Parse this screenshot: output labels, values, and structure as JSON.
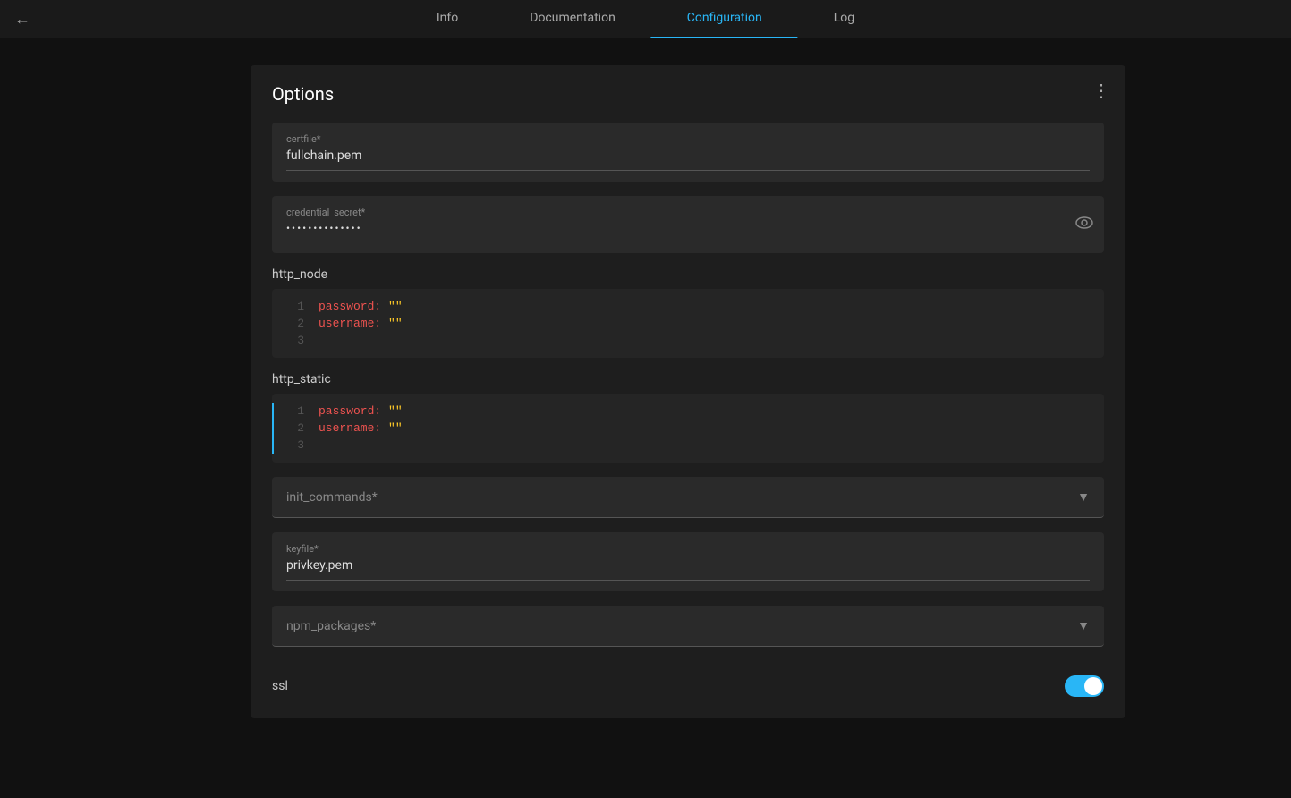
{
  "nav": {
    "back_label": "←",
    "tabs": [
      {
        "id": "info",
        "label": "Info",
        "active": false
      },
      {
        "id": "documentation",
        "label": "Documentation",
        "active": false
      },
      {
        "id": "configuration",
        "label": "Configuration",
        "active": true
      },
      {
        "id": "log",
        "label": "Log",
        "active": false
      }
    ]
  },
  "panel": {
    "title": "Options",
    "menu_icon": "⋮",
    "fields": {
      "certfile": {
        "label": "certfile*",
        "value": "fullchain.pem"
      },
      "credential_secret": {
        "label": "credential_secret*",
        "value": "••••••••••••••"
      }
    },
    "http_node": {
      "section_label": "http_node",
      "lines": [
        {
          "number": "1",
          "key": "password:",
          "value": "\"\"",
          "active": false
        },
        {
          "number": "2",
          "key": "username:",
          "value": "\"\"",
          "active": false
        },
        {
          "number": "3",
          "key": "",
          "value": "",
          "active": false
        }
      ]
    },
    "http_static": {
      "section_label": "http_static",
      "lines": [
        {
          "number": "1",
          "key": "password:",
          "value": "\"\"",
          "active": true
        },
        {
          "number": "2",
          "key": "username:",
          "value": "\"\"",
          "active": true
        },
        {
          "number": "3",
          "key": "",
          "value": "",
          "active": true
        }
      ]
    },
    "init_commands": {
      "label": "init_commands*"
    },
    "keyfile": {
      "label": "keyfile*",
      "value": "privkey.pem"
    },
    "npm_packages": {
      "label": "npm_packages*"
    },
    "ssl": {
      "label": "ssl",
      "enabled": true
    }
  }
}
